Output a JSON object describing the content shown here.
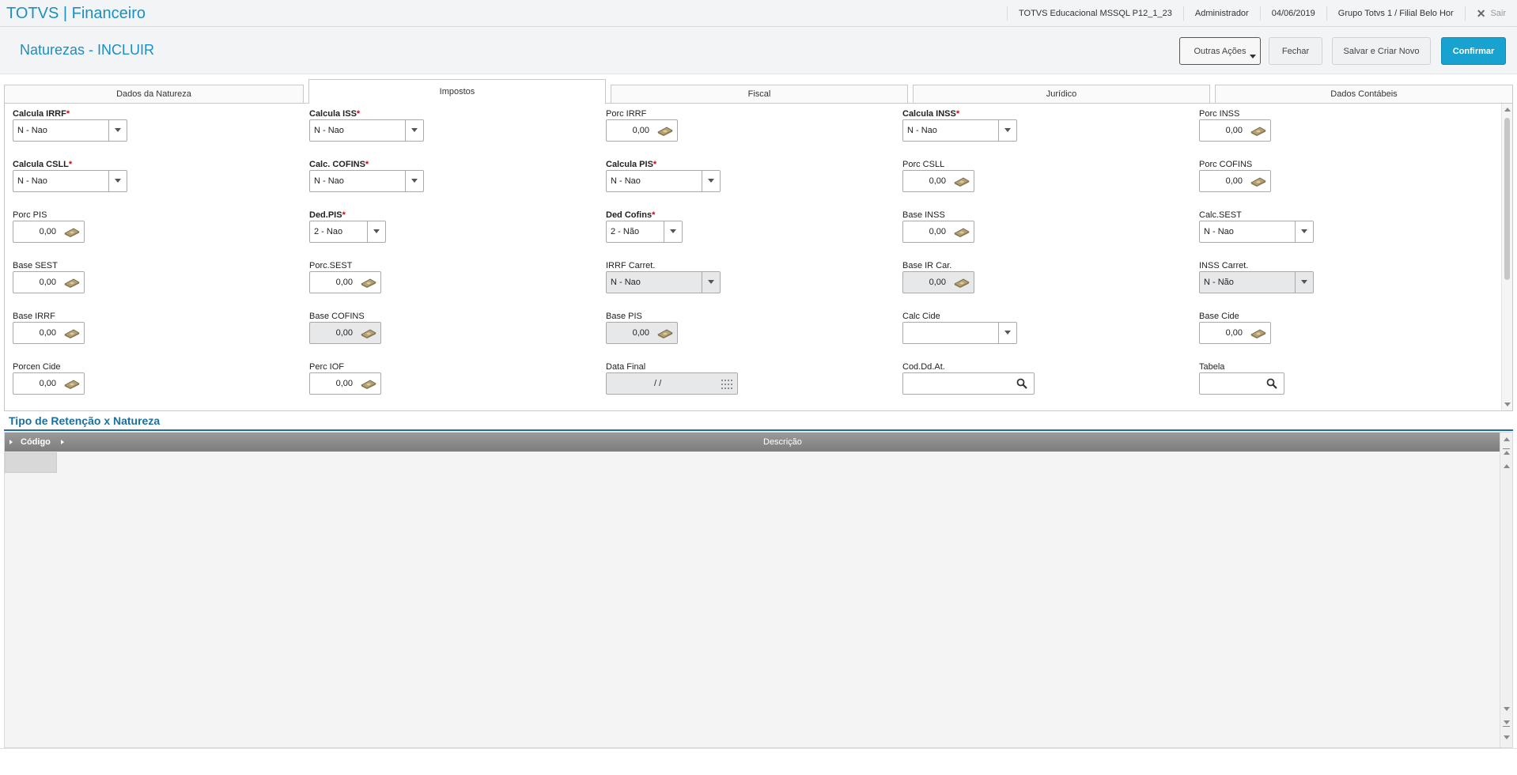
{
  "topbar": {
    "app_title": "TOTVS | Financeiro",
    "environment": "TOTVS Educacional MSSQL P12_1_23",
    "user": "Administrador",
    "date": "04/06/2019",
    "company": "Grupo Totvs 1 / Filial Belo Hor",
    "exit_label": "Sair"
  },
  "header": {
    "page_title": "Naturezas - INCLUIR",
    "buttons": {
      "more_actions": "Outras Ações",
      "close": "Fechar",
      "save_new": "Salvar e Criar Novo",
      "confirm": "Confirmar"
    }
  },
  "tabs": [
    "Dados da Natureza",
    "Impostos",
    "Fiscal",
    "Jurídico",
    "Dados Contábeis"
  ],
  "active_tab": "Impostos",
  "fields": {
    "calcula_irrf": {
      "label": "Calcula IRRF",
      "value": "N - Nao"
    },
    "calcula_iss": {
      "label": "Calcula ISS",
      "value": "N - Nao"
    },
    "porc_irrf": {
      "label": "Porc IRRF",
      "value": "0,00"
    },
    "calcula_inss": {
      "label": "Calcula INSS",
      "value": "N - Nao"
    },
    "porc_inss": {
      "label": "Porc INSS",
      "value": "0,00"
    },
    "calcula_csll": {
      "label": "Calcula CSLL",
      "value": "N - Nao"
    },
    "calc_cofins": {
      "label": "Calc. COFINS",
      "value": "N - Nao"
    },
    "calcula_pis": {
      "label": "Calcula PIS",
      "value": "N - Nao"
    },
    "porc_csll": {
      "label": "Porc CSLL",
      "value": "0,00"
    },
    "porc_cofins": {
      "label": "Porc COFINS",
      "value": "0,00"
    },
    "porc_pis": {
      "label": "Porc PIS",
      "value": "0,00"
    },
    "ded_pis": {
      "label": "Ded.PIS",
      "value": "2 - Nao"
    },
    "ded_cofins": {
      "label": "Ded Cofins",
      "value": "2 - Não"
    },
    "base_inss": {
      "label": "Base INSS",
      "value": "0,00"
    },
    "calc_sest": {
      "label": "Calc.SEST",
      "value": "N - Nao"
    },
    "base_sest": {
      "label": "Base SEST",
      "value": "0,00"
    },
    "porc_sest": {
      "label": "Porc.SEST",
      "value": "0,00"
    },
    "irrf_carret": {
      "label": "IRRF Carret.",
      "value": "N - Nao"
    },
    "base_ir_car": {
      "label": "Base IR Car.",
      "value": "0,00"
    },
    "inss_carret": {
      "label": "INSS Carret.",
      "value": "N - Não"
    },
    "base_irrf": {
      "label": "Base IRRF",
      "value": "0,00"
    },
    "base_cofins": {
      "label": "Base COFINS",
      "value": "0,00"
    },
    "base_pis": {
      "label": "Base PIS",
      "value": "0,00"
    },
    "calc_cide": {
      "label": "Calc Cide",
      "value": ""
    },
    "base_cide": {
      "label": "Base Cide",
      "value": "0,00"
    },
    "porcen_cide": {
      "label": "Porcen Cide",
      "value": "0,00"
    },
    "perc_iof": {
      "label": "Perc IOF",
      "value": "0,00"
    },
    "data_final": {
      "label": "Data Final",
      "value": " /  /"
    },
    "cod_dd_at": {
      "label": "Cod.Dd.At.",
      "value": ""
    },
    "tabela": {
      "label": "Tabela",
      "value": ""
    }
  },
  "required_marker": "*",
  "section": {
    "title": "Tipo de Retenção x Natureza",
    "columns": [
      "Código",
      "Descrição"
    ]
  },
  "colors": {
    "brand": "#1a8fc0",
    "primary_button": "#17a2cf",
    "required": "#d0021b",
    "section_title": "#1a6f9c"
  },
  "icons": {
    "money": "money-icon",
    "search": "search-icon",
    "calendar": "calendar-icon",
    "close": "close-icon"
  }
}
